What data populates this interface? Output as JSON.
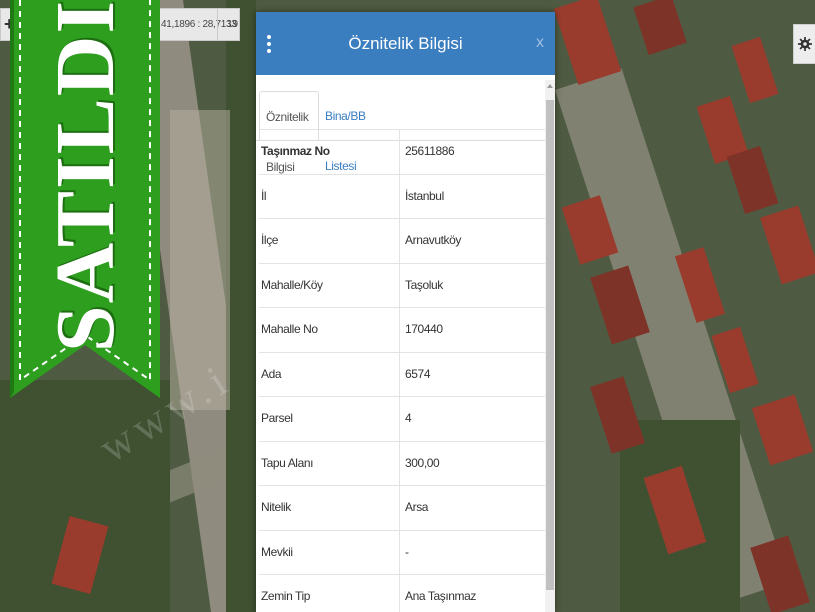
{
  "coordinates": {
    "plus_label": "+",
    "text": "41,1896 : 28,7133",
    "zoom": "19"
  },
  "badge": {
    "text": "SATILDI",
    "color": "#2d9e1e"
  },
  "watermark": {
    "text": "www.i"
  },
  "panel": {
    "title": "Öznitelik Bilgisi",
    "close_label": "x",
    "accent_color": "#3a7ec0",
    "tabs": [
      {
        "label": "Öznitelik Bilgisi",
        "active": true
      },
      {
        "label": "Bina/BB Listesi",
        "active": false
      }
    ],
    "rows": [
      {
        "key": "Taşınmaz No",
        "value": "25611886"
      },
      {
        "key": "İl",
        "value": "İstanbul"
      },
      {
        "key": "İlçe",
        "value": "Arnavutköy"
      },
      {
        "key": "Mahalle/Köy",
        "value": "Taşoluk"
      },
      {
        "key": "Mahalle No",
        "value": "170440"
      },
      {
        "key": "Ada",
        "value": "6574"
      },
      {
        "key": "Parsel",
        "value": "4"
      },
      {
        "key": "Tapu Alanı",
        "value": "300,00"
      },
      {
        "key": "Nitelik",
        "value": "Arsa"
      },
      {
        "key": "Mevkii",
        "value": "-"
      },
      {
        "key": "Zemin Tip",
        "value": "Ana Taşınmaz"
      }
    ]
  },
  "icons": {
    "menu": "vertical-dots-icon",
    "settings": "gear-icon",
    "close": "close-icon"
  }
}
